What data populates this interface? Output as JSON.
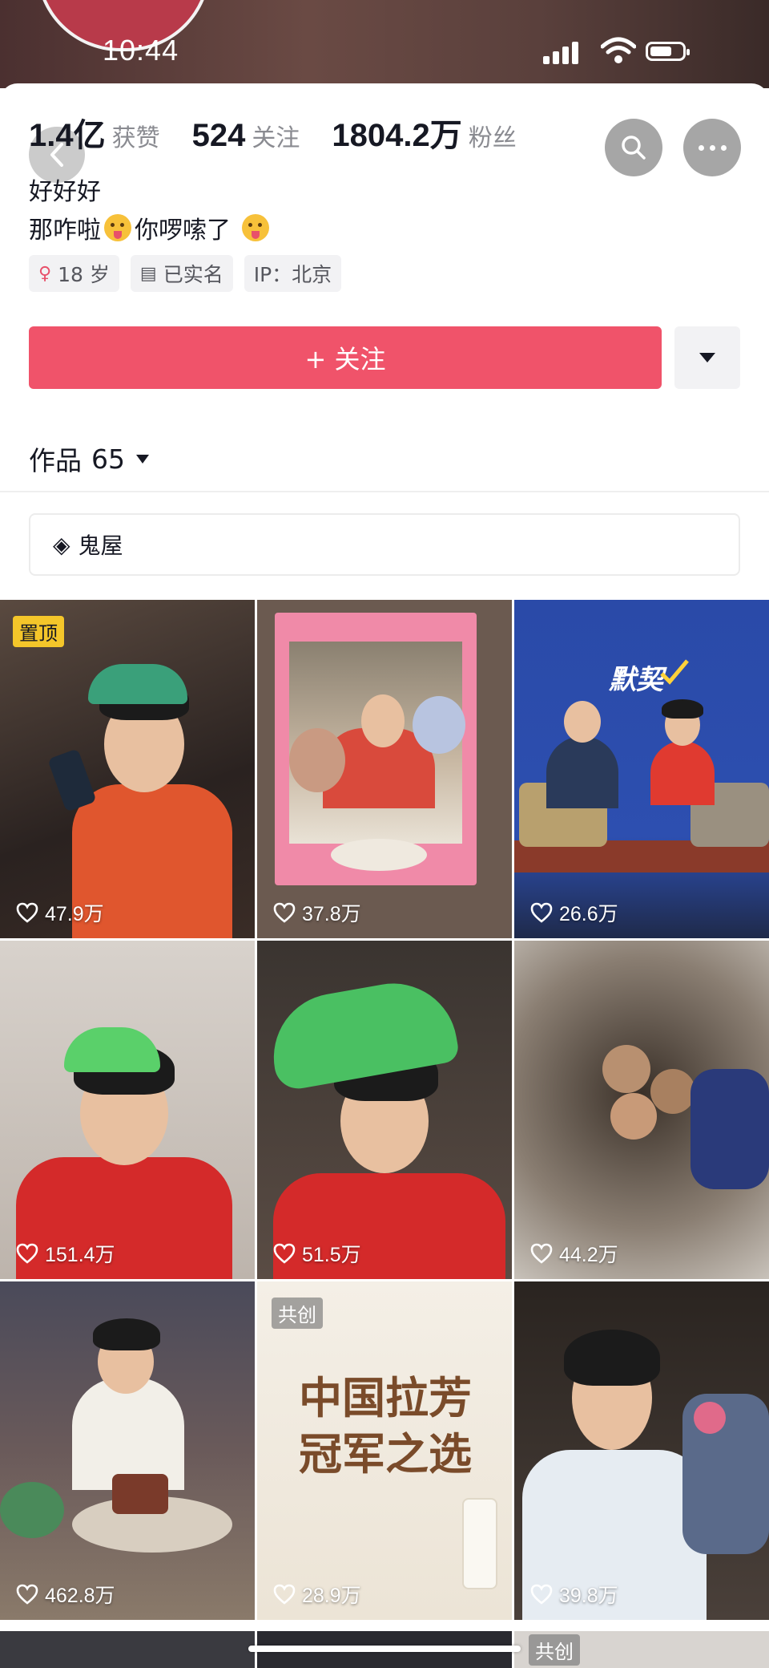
{
  "status_bar": {
    "time": "10:44"
  },
  "profile": {
    "stats": [
      {
        "value": "1.4亿",
        "label": "获赞"
      },
      {
        "value": "524",
        "label": "关注"
      },
      {
        "value": "1804.2万",
        "label": "粉丝"
      }
    ],
    "bio_line1": "好好好",
    "bio_line2_part1": "那咋啦",
    "bio_line2_part2": "你啰嗦了",
    "tags": {
      "age": "18 岁",
      "verified": "已实名",
      "ip": "IP：北京"
    },
    "follow_label": "+ 关注"
  },
  "works": {
    "label": "作品",
    "count": "65"
  },
  "collection": {
    "label": "鬼屋"
  },
  "videos": [
    {
      "likes": "47.9万",
      "badge": "置顶"
    },
    {
      "likes": "37.8万"
    },
    {
      "likes": "26.6万",
      "overlay_text": "默契"
    },
    {
      "likes": "151.4万"
    },
    {
      "likes": "51.5万"
    },
    {
      "likes": "44.2万"
    },
    {
      "likes": "462.8万"
    },
    {
      "likes": "28.9万",
      "badge": "共创",
      "overlay_text_1": "中国拉芳",
      "overlay_text_2": "冠军之选"
    },
    {
      "likes": "39.8万"
    }
  ],
  "next_row": {
    "badge": "共创"
  },
  "colors": {
    "accent": "#f0536a",
    "pin_badge": "#f4c62a"
  }
}
